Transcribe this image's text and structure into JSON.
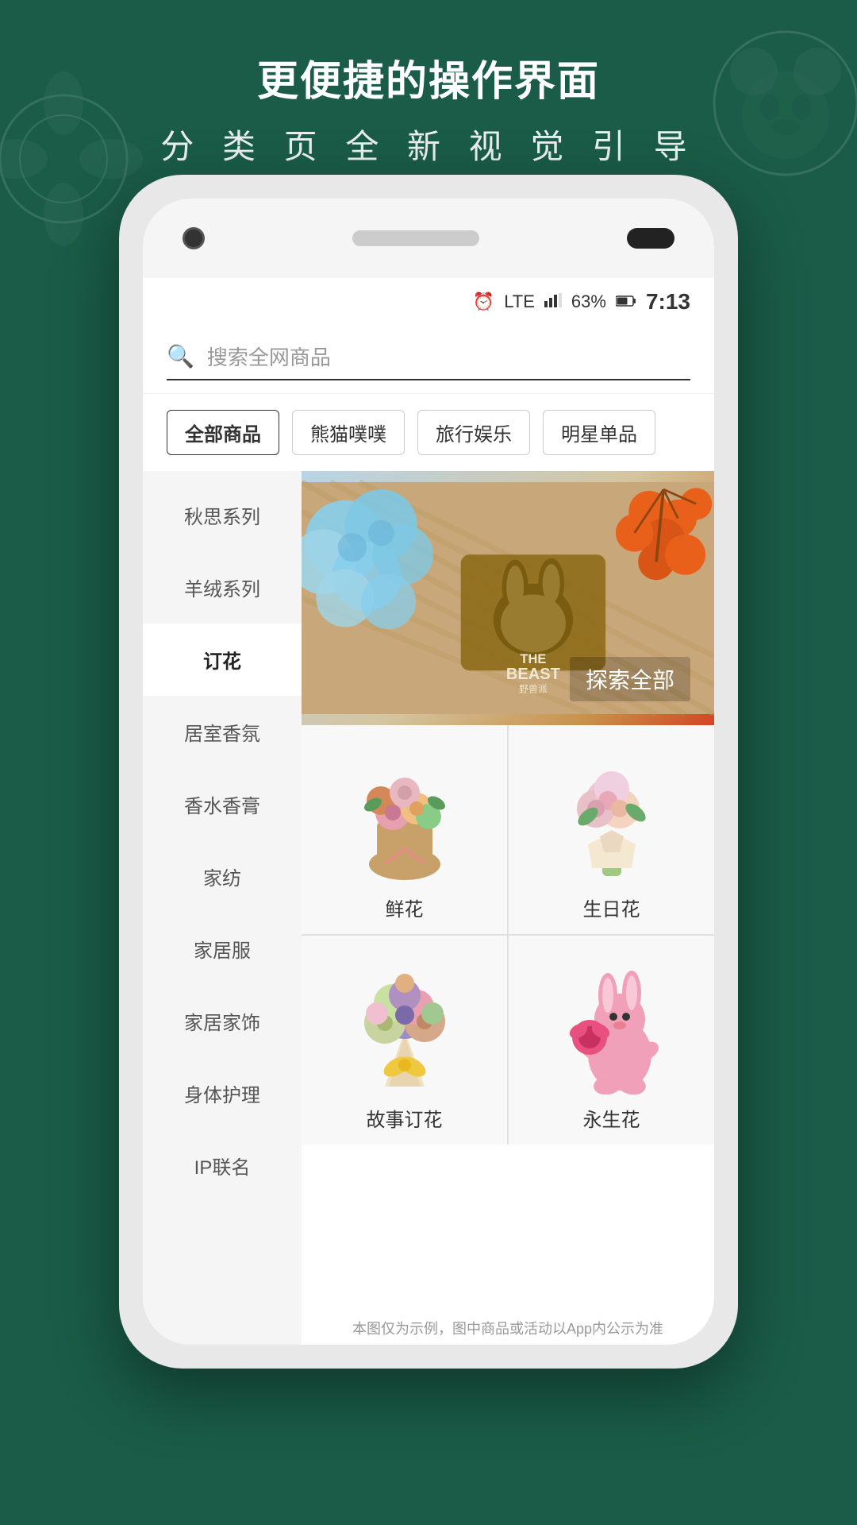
{
  "background": {
    "color": "#1a5c47"
  },
  "header": {
    "title": "更便捷的操作界面",
    "subtitle": "分 类 页 全 新 视 觉 引 导"
  },
  "status_bar": {
    "battery": "63%",
    "time": "7:13",
    "signal": "LTE"
  },
  "search": {
    "placeholder": "搜索全网商品"
  },
  "tabs": [
    {
      "label": "全部商品",
      "active": true
    },
    {
      "label": "熊猫噗噗",
      "active": false
    },
    {
      "label": "旅行娱乐",
      "active": false
    },
    {
      "label": "明星单品",
      "active": false
    }
  ],
  "sidebar": [
    {
      "label": "秋思系列",
      "active": false
    },
    {
      "label": "羊绒系列",
      "active": false
    },
    {
      "label": "订花",
      "active": true
    },
    {
      "label": "居室香氛",
      "active": false
    },
    {
      "label": "香水香膏",
      "active": false
    },
    {
      "label": "家纺",
      "active": false
    },
    {
      "label": "家居服",
      "active": false
    },
    {
      "label": "家居家饰",
      "active": false
    },
    {
      "label": "身体护理",
      "active": false
    },
    {
      "label": "IP联名",
      "active": false
    }
  ],
  "banner": {
    "label": "探索全部",
    "brand": "THE BEAST 野兽派"
  },
  "products": [
    {
      "label": "鲜花"
    },
    {
      "label": "生日花"
    },
    {
      "label": "故事订花"
    },
    {
      "label": "永生花"
    }
  ],
  "disclaimer": "本图仅为示例，图中商品或活动以App内公示为准"
}
